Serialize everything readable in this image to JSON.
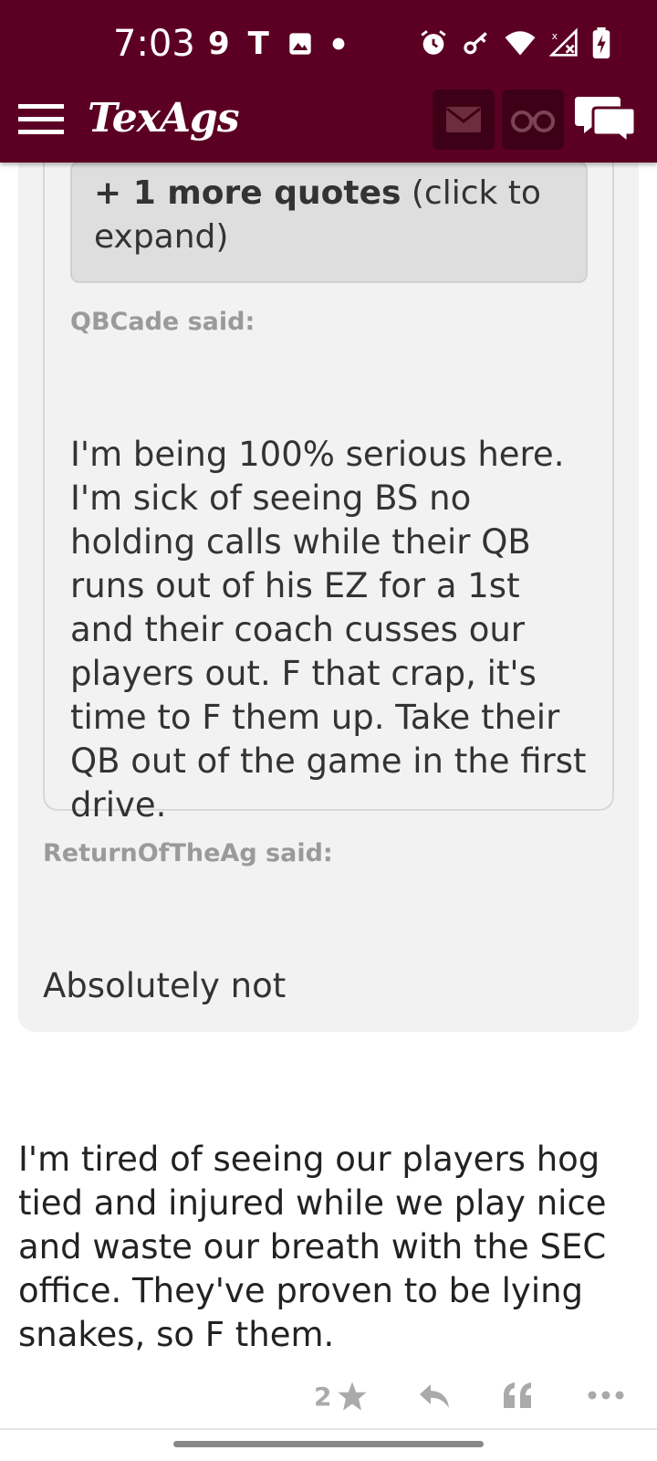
{
  "status_bar": {
    "time": "7:03",
    "left_icons": [
      "9",
      "T",
      "image-icon",
      "dot"
    ],
    "right_icons": [
      "alarm-icon",
      "key-icon",
      "wifi-icon",
      "signal-icon",
      "battery-icon"
    ]
  },
  "app_bar": {
    "logo": "TexAgs",
    "brand_color": "#5c0023",
    "buttons": [
      "mail-icon",
      "binoculars-icon",
      "chat-icon"
    ]
  },
  "quote": {
    "more_quotes_bold": "+ 1 more quotes",
    "more_quotes_rest": " (click to expand)",
    "inner_author": "QBCade said:",
    "inner_text": "I'm being 100% serious here. I'm sick of seeing BS no holding calls while their QB runs out of his EZ for a 1st and their coach cusses our players out. F that crap, it's time to F them up. Take their QB out of the game in the first drive.",
    "outer_author": "ReturnOfTheAg said:",
    "outer_text": "Absolutely not"
  },
  "post": {
    "text": "I'm tired of seeing our players hog tied and injured while we play nice and waste our breath with the SEC office. They've proven to be lying snakes, so F them.",
    "like_count": "2"
  }
}
